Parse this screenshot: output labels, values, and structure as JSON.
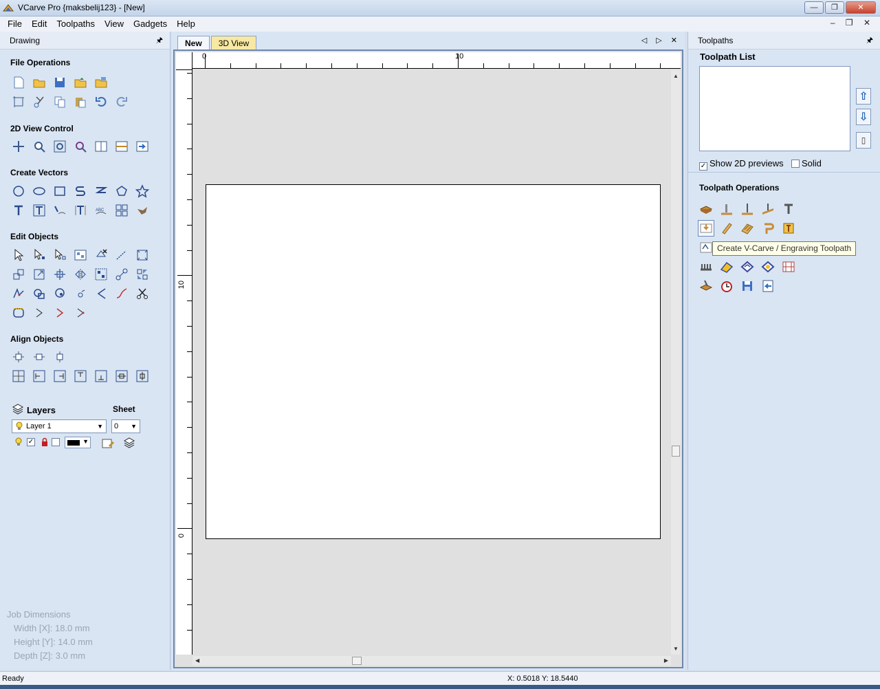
{
  "window": {
    "title": "VCarve Pro {maksbelij123} - [New]",
    "buttons": {
      "minimize": "—",
      "restore": "❐",
      "close": "✕"
    }
  },
  "menu": {
    "items": [
      {
        "label": "File",
        "accel": "F"
      },
      {
        "label": "Edit",
        "accel": "E"
      },
      {
        "label": "Toolpaths",
        "accel": ""
      },
      {
        "label": "View",
        "accel": "V"
      },
      {
        "label": "Gadgets",
        "accel": ""
      },
      {
        "label": "Help",
        "accel": "H"
      }
    ],
    "mdi": "– ❐ ✕"
  },
  "left_panel": {
    "title": "Drawing",
    "pin": "🖈",
    "sections": {
      "file_ops": "File Operations",
      "view_ctrl": "2D View Control",
      "create_vectors": "Create Vectors",
      "edit_objects": "Edit Objects",
      "align_objects": "Align Objects"
    },
    "layers": {
      "label": "Layers",
      "sheet_label": "Sheet",
      "layer_value": "Layer 1",
      "sheet_value": "0"
    },
    "job_dimensions": {
      "title": "Job Dimensions",
      "width": "Width  [X]: 18.0 mm",
      "height": "Height [Y]: 14.0 mm",
      "depth": "Depth  [Z]: 3.0 mm"
    }
  },
  "center": {
    "tabs": [
      {
        "label": "New"
      },
      {
        "label": "3D View"
      }
    ],
    "tab_controls": "◁ ▷ ✕",
    "ruler": {
      "h_labels": [
        "0",
        "10"
      ],
      "v_labels": [
        "10",
        "0"
      ]
    }
  },
  "right_panel": {
    "title": "Toolpaths",
    "list_title": "Toolpath List",
    "show_previews": "Show 2D previews",
    "show_previews_checked": true,
    "solid": "Solid",
    "solid_checked": false,
    "ops_title": "Toolpath Operations",
    "tooltip": "Create V-Carve / Engraving  Toolpath"
  },
  "status": {
    "text": "Ready",
    "coords": "X: 0.5018 Y: 18.5440"
  },
  "colors": {
    "panel_bg": "#d9e5f3",
    "accent_blue": "#2d5ea8",
    "tab_yellow": "#f7e9a3",
    "tooltip_bg": "#ffffe8"
  }
}
